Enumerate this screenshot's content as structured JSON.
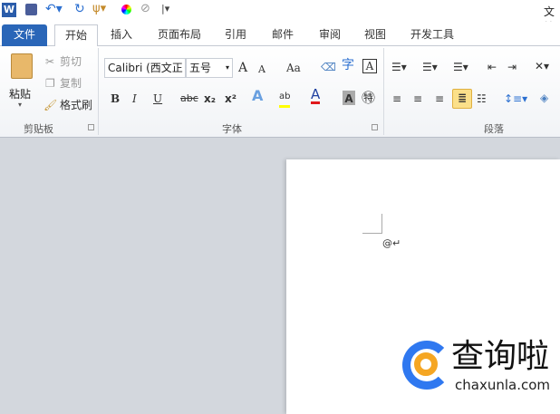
{
  "title_bar": {
    "app_icon": "word-icon",
    "quick_access": [
      "save-icon",
      "undo-icon",
      "redo-icon",
      "paint-icon",
      "color-icon",
      "eraser-icon",
      "customize-dropdown-icon"
    ],
    "title": "文档"
  },
  "tabs": [
    {
      "label": "文件"
    },
    {
      "label": "开始",
      "active": true
    },
    {
      "label": "插入"
    },
    {
      "label": "页面布局"
    },
    {
      "label": "引用"
    },
    {
      "label": "邮件"
    },
    {
      "label": "审阅"
    },
    {
      "label": "视图"
    },
    {
      "label": "开发工具"
    }
  ],
  "clipboard": {
    "paste": "粘贴",
    "cut": "剪切",
    "copy": "复制",
    "format_painter": "格式刷",
    "group": "剪贴板"
  },
  "font": {
    "font_name": "Calibri (西文正",
    "font_size": "五号",
    "grow": "A",
    "shrink": "A",
    "case": "Aa",
    "bold": "B",
    "italic": "I",
    "underline": "U",
    "strike": "abc",
    "subscript": "x₂",
    "superscript": "x²",
    "group": "字体",
    "highlight_color": "#ffff00",
    "font_color": "#e0191c"
  },
  "paragraph": {
    "group": "段落"
  },
  "document": {
    "text": "@↵"
  },
  "watermark": {
    "brand": "查询啦",
    "domain": "chaxunla.com",
    "colors": {
      "ring": "#2f78f0",
      "magnifier": "#f5a623"
    }
  }
}
